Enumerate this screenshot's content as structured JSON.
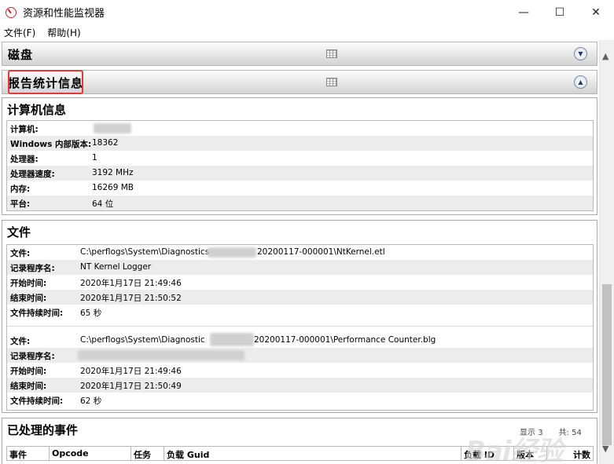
{
  "window": {
    "title": "资源和性能监视器",
    "controls": {
      "minimize": "—",
      "maximize": "☐",
      "close": "✕"
    }
  },
  "menu": [
    {
      "label": "文件(F)"
    },
    {
      "label": "帮助(H)"
    }
  ],
  "sections": {
    "disk": {
      "title": "磁盘",
      "toggle_icon": "chevron-down-circle-icon"
    },
    "report_stats": {
      "title": "报告统计信息",
      "toggle_icon": "chevron-up-circle-icon"
    }
  },
  "computer_info": {
    "title": "计算机信息",
    "rows": [
      {
        "key": "计算机:",
        "value": ""
      },
      {
        "key": "Windows 内部版本:",
        "value": "18362"
      },
      {
        "key": "处理器:",
        "value": "1"
      },
      {
        "key": "处理器速度:",
        "value": "3192 MHz"
      },
      {
        "key": "内存:",
        "value": "16269 MB"
      },
      {
        "key": "平台:",
        "value": "64 位"
      }
    ]
  },
  "files": {
    "title": "文件",
    "file1": {
      "rows": [
        {
          "key": "文件:",
          "value": "C:\\perflogs\\System\\Diagnostics",
          "value_suffix": "20200117-000001\\NtKernel.etl"
        },
        {
          "key": "记录程序名:",
          "value": "NT Kernel Logger"
        },
        {
          "key": "开始时间:",
          "value": "2020年1月17日  21:49:46"
        },
        {
          "key": "结束时间:",
          "value": "2020年1月17日  21:50:52"
        },
        {
          "key": "文件持续时间:",
          "value": "65 秒"
        }
      ]
    },
    "file2": {
      "rows": [
        {
          "key": "文件:",
          "value": "C:\\perflogs\\System\\Diagnostic",
          "value_suffix": "20200117-000001\\Performance Counter.blg"
        },
        {
          "key": "记录程序名:",
          "value": ""
        },
        {
          "key": "开始时间:",
          "value": "2020年1月17日  21:49:46"
        },
        {
          "key": "结束时间:",
          "value": "2020年1月17日  21:50:49"
        },
        {
          "key": "文件持续时间:",
          "value": "62 秒"
        }
      ]
    }
  },
  "events": {
    "title": "已处理的事件",
    "counts": {
      "shown_label": "显示",
      "shown_value": "3",
      "total_label": "共:",
      "total_value": "54"
    },
    "columns": [
      "事件",
      "Opcode",
      "任务",
      "负载  Guid",
      "负载  ID",
      "版本",
      "计数"
    ]
  },
  "watermark": "Bai经验"
}
